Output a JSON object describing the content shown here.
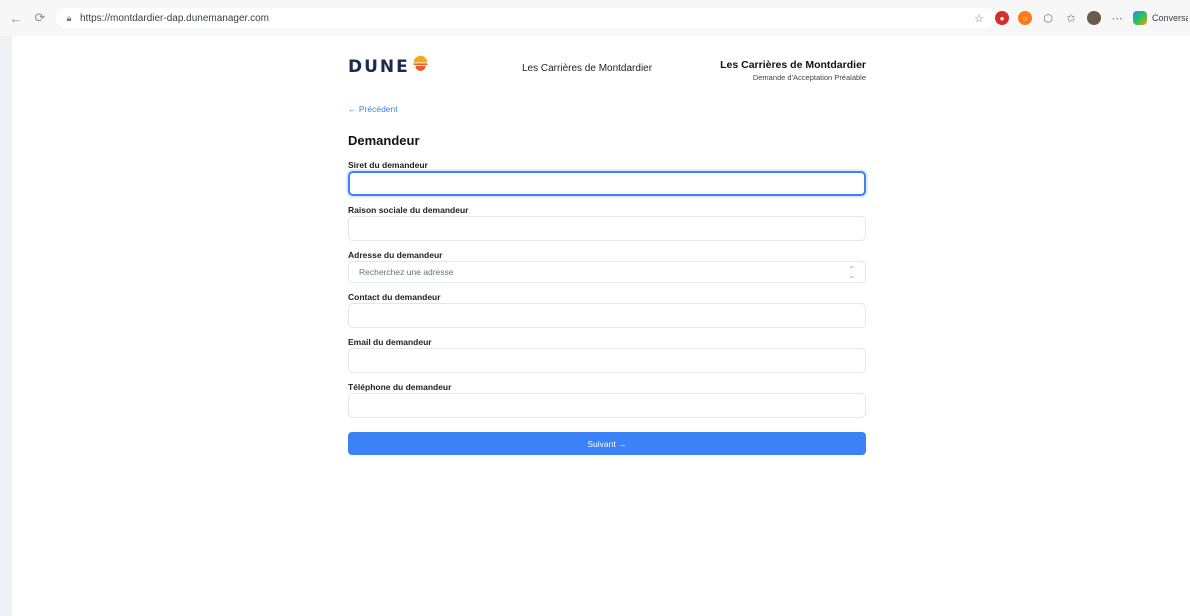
{
  "browser": {
    "url": "https://montdardier-dap.dunemanager.com",
    "sidebar_label": "Conversatio"
  },
  "header": {
    "logo_text": "DUNE",
    "center_title": "Les Carrières de Montdardier",
    "right_title": "Les Carrières de Montdardier",
    "right_subtitle": "Demande d'Acceptation Préalable"
  },
  "nav": {
    "back_label": "← Précédent"
  },
  "section": {
    "title": "Demandeur"
  },
  "fields": {
    "siret": {
      "label": "Siret du demandeur",
      "value": ""
    },
    "raison_sociale": {
      "label": "Raison sociale du demandeur",
      "value": ""
    },
    "adresse": {
      "label": "Adresse du demandeur",
      "placeholder": "Recherchez une adresse"
    },
    "contact": {
      "label": "Contact du demandeur",
      "value": ""
    },
    "email": {
      "label": "Email du demandeur",
      "value": ""
    },
    "telephone": {
      "label": "Téléphone du demandeur",
      "value": ""
    }
  },
  "actions": {
    "next_label": "Suivant →"
  },
  "colors": {
    "accent": "#3b82f6",
    "logo": "#1d2a4d",
    "sun_top": "#f5a623",
    "sun_bottom": "#e85d2a"
  }
}
